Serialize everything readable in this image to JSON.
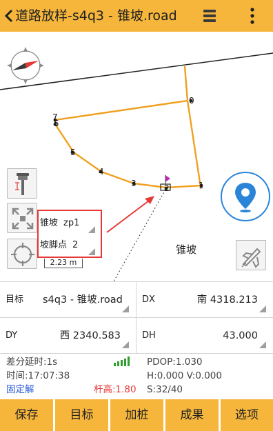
{
  "header": {
    "title": "道路放样-s4q3 - 锥坡.road",
    "back_icon": "chevron-left-icon",
    "menu_icon": "layers-menu-icon",
    "more_icon": "more-vertical-icon"
  },
  "map": {
    "point_labels": [
      "0",
      "7",
      "5",
      "5",
      "4",
      "3",
      "2",
      "1"
    ],
    "popup": {
      "row1_label": "锥坡",
      "row1_value": "zp1",
      "row2_label": "坡脚点",
      "row2_value": "2"
    },
    "scale_text": "2.23 m",
    "slope_label": "锥坡",
    "icons": {
      "compass": "compass-icon",
      "antenna": "antenna-pole-icon",
      "full_extent": "full-extent-icon",
      "locate": "crosshair-target-icon",
      "location": "location-pin-icon",
      "fly": "fly-icon"
    }
  },
  "info": {
    "target_label": "目标",
    "target_value": "s4q3 - 锥坡.road",
    "dx_label": "DX",
    "dx_value": "南 4318.213",
    "dy_label": "DY",
    "dy_value": "西 2340.583",
    "dh_label": "DH",
    "dh_value": "43.000"
  },
  "status": {
    "diff_delay": "差分延时:1s",
    "time": "时间:17:07:38",
    "fix": "固定解",
    "pole_height": "杆高:1.80",
    "pdop": "PDOP:1.030",
    "hv": "H:0.000  V:0.000",
    "sats": "S:32/40"
  },
  "colors": {
    "accent": "#f6b63c",
    "fix_blue": "#2a5bd8",
    "pole_red": "#e53935",
    "signal_green": "#2e9e2e",
    "route_orange": "#f0a020"
  },
  "bottom": {
    "btn1": "保存",
    "btn2": "目标",
    "btn3": "加桩",
    "btn4": "成果",
    "btn5": "选项"
  }
}
